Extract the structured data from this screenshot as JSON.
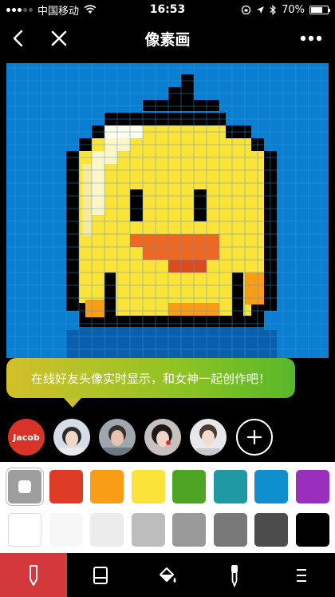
{
  "status_bar": {
    "carrier": "中国移动",
    "time": "16:53",
    "battery": "70%"
  },
  "nav": {
    "title": "像素画"
  },
  "tooltip": {
    "text": "在线好友头像实时显示，和女神一起创作吧！"
  },
  "collaborators": {
    "me_label": "Jacob"
  },
  "colors": {
    "canvas_bg": "#0a7fd1",
    "grid": "#3d9ae0",
    "tooltip_start": "#d3c02a",
    "tooltip_end": "#57b72a",
    "active_tool": "#d3383d"
  },
  "palette": {
    "row1": [
      "#9e9e9e",
      "#dd3b26",
      "#f99d17",
      "#fbe33a",
      "#4ea524",
      "#1f9aa5",
      "#0f8fce",
      "#9a2fbe"
    ],
    "row2": [
      "#ffffff",
      "#f7f7f7",
      "#ececec",
      "#bdbdbd",
      "#9a9a9a",
      "#787878",
      "#4c4c4c",
      "#000000"
    ],
    "selected_index": 0
  },
  "toolbar": {
    "tools": [
      "pencil-icon",
      "eraser-icon",
      "fill-bucket-icon",
      "eyedropper-icon",
      "menu-icon"
    ],
    "active_index": 0
  }
}
